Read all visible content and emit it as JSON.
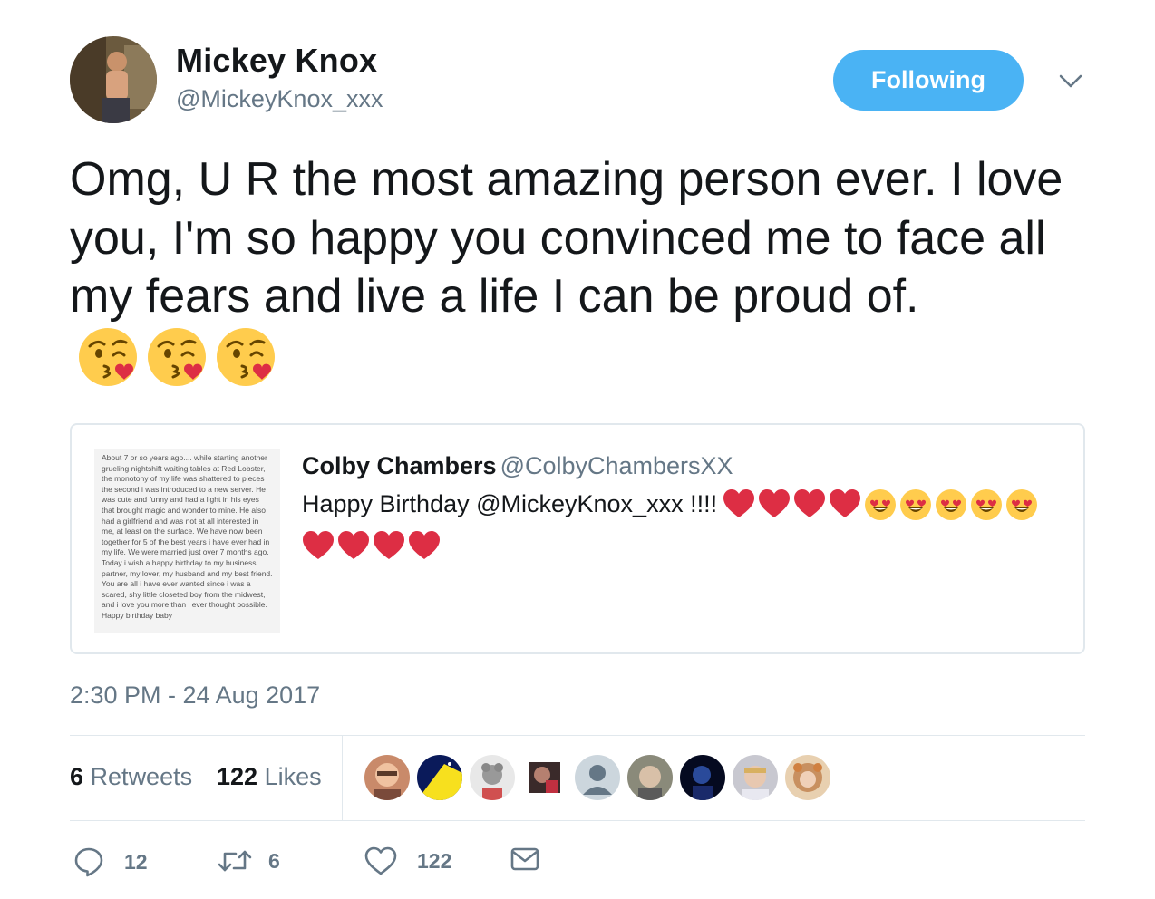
{
  "author": {
    "display_name": "Mickey Knox",
    "handle": "@MickeyKnox_xxx",
    "avatar_icon": "profile-photo"
  },
  "follow_button": {
    "label": "Following",
    "color": "#4ab3f4"
  },
  "tweet": {
    "text": "Omg, U R the most amazing person ever.  I love you, I'm so happy you convinced me to face all my fears and live a life I can be proud of.",
    "trailing_emojis": [
      "kissing-heart-emoji",
      "kissing-heart-emoji",
      "kissing-heart-emoji"
    ]
  },
  "quoted_tweet": {
    "display_name": "Colby Chambers",
    "handle": "@ColbyChambersXX",
    "text": "Happy Birthday @MickeyKnox_xxx !!!!",
    "emojis_line1": [
      "red-heart",
      "red-heart",
      "red-heart",
      "red-heart",
      "heart-eyes",
      "heart-eyes",
      "heart-eyes",
      "heart-eyes",
      "heart-eyes"
    ],
    "emojis_line2": [
      "red-heart",
      "red-heart",
      "red-heart",
      "red-heart"
    ],
    "image_text": "About 7 or so years ago.... while starting another grueling nightshift waiting tables at Red Lobster, the monotony of my life was shattered to pieces the second i was introduced to a new server. He was cute and funny and had a light in his eyes that brought magic and wonder to mine. He also had a girlfriend and was not at all interested in me, at least on the surface. We have now been together for 5 of the best years i have ever had in my life. We were married just over 7 months ago. Today i wish a happy birthday to my business partner, my lover, my husband and my best friend. You are all i have ever wanted since i was a scared, shy little closeted boy from the midwest, and i love you more than i ever thought possible. Happy birthday baby"
  },
  "timestamp": "2:30 PM - 24 Aug 2017",
  "stats": {
    "retweets_count": "6",
    "retweets_label": "Retweets",
    "likes_count": "122",
    "likes_label": "Likes"
  },
  "likers_count": 9,
  "actions": {
    "reply_count": "12",
    "retweet_count": "6",
    "like_count": "122"
  },
  "colors": {
    "text": "#14171a",
    "secondary": "#657786",
    "border": "#e1e8ed",
    "heart_red": "#dd2e44",
    "emoji_yellow": "#ffcc4d"
  }
}
